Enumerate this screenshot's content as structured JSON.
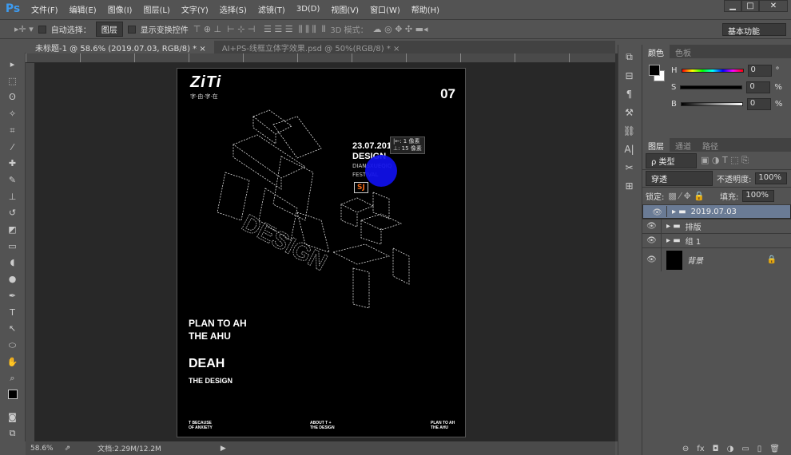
{
  "app": {
    "logo": "Ps"
  },
  "menu": [
    "文件(F)",
    "编辑(E)",
    "图像(I)",
    "图层(L)",
    "文字(Y)",
    "选择(S)",
    "滤镜(T)",
    "3D(D)",
    "视图(V)",
    "窗口(W)",
    "帮助(H)"
  ],
  "window_controls": [
    "▁",
    "□",
    "✕"
  ],
  "options": {
    "auto_select_label": "自动选择：",
    "auto_select_value": "图层",
    "show_transform_label": "显示变换控件",
    "mode_3d_label": "3D 模式：",
    "workspace": "基本功能"
  },
  "tabs": [
    {
      "label": "未标题-1 @ 58.6% (2019.07.03, RGB/8) *",
      "close": "×"
    },
    {
      "label": "AI+PS-线框立体字效果.psd @ 50%(RGB/8) *",
      "close": "×"
    }
  ],
  "poster": {
    "brand": "ZiTi",
    "brand_sub": "字·由·字·在",
    "issue": "07",
    "date": "23.07.2019",
    "design": "DESIGN",
    "sub1": "DIANSXUEQIQ",
    "sub2": "FESTIVAL",
    "badge": "SJ",
    "wire_text": "DESIGN",
    "h1": "PLAN TO AH",
    "h2": "THE AHU",
    "h3": "DEAH",
    "h4": "THE DESIGN",
    "foot": [
      {
        "l1": "T BECAUSE",
        "l2": "OF ANXIETY"
      },
      {
        "l1": "ABOUT T +",
        "l2": "THE DESIGN"
      },
      {
        "l1": "PLAN TO AH",
        "l2": "THE AHU"
      }
    ]
  },
  "tooltip": {
    "line1": "|←:  1 像素",
    "line2": "⊥: 15 像素"
  },
  "status": {
    "zoom": "58.6%",
    "doc": "文档:2.29M/12.2M"
  },
  "color_panel": {
    "tabs": [
      "颜色",
      "色板"
    ],
    "h_label": "H",
    "h": "0",
    "h_unit": "°",
    "s_label": "S",
    "s": "0",
    "s_unit": "%",
    "b_label": "B",
    "b": "0",
    "b_unit": "%"
  },
  "layers_panel": {
    "tabs": [
      "图层",
      "通道",
      "路径"
    ],
    "filter": "ρ 类型",
    "blend": "穿透",
    "opacity_label": "不透明度:",
    "opacity": "100%",
    "lock_label": "锁定:",
    "fill_label": "填充:",
    "fill": "100%",
    "layers": [
      {
        "name": "2019.07.03",
        "type": "group",
        "selected": true
      },
      {
        "name": "排版",
        "type": "group"
      },
      {
        "name": "组 1",
        "type": "group"
      },
      {
        "name": "背景",
        "type": "background"
      }
    ]
  },
  "panel_footer": [
    "⊖",
    "fx",
    "◘",
    "◑",
    "▭",
    "▯",
    "🗑"
  ]
}
